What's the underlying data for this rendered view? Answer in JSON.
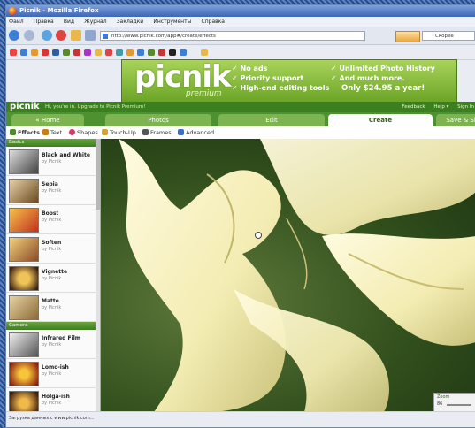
{
  "window": {
    "title": "Picnik - Mozilla Firefox"
  },
  "menu": [
    "Файл",
    "Правка",
    "Вид",
    "Журнал",
    "Закладки",
    "Инструменты",
    "Справка"
  ],
  "navbar": {
    "url": "http://www.picnik.com/app#/create/effects",
    "search_placeholder": "Скорее"
  },
  "ad": {
    "logo": "picnik",
    "sub": "premium",
    "left": [
      "No ads",
      "Priority support",
      "High-end editing tools"
    ],
    "right": [
      "Unlimited Photo History",
      "And much more."
    ],
    "price": "Only $24.95 a year!"
  },
  "picnikbar": {
    "logo": "picnik",
    "message": "Hi, you're in. Upgrade to Picnik Premium!",
    "links": [
      "Feedback",
      "Help ▾",
      "Sign In"
    ]
  },
  "tabs": [
    "« Home",
    "Photos",
    "Edit",
    "Create",
    "Save & Share"
  ],
  "active_tab": "Create",
  "subtabs": [
    "Effects",
    "Text",
    "Shapes",
    "Touch-Up",
    "Frames",
    "Advanced"
  ],
  "sections": [
    {
      "title": "Basics",
      "items": [
        {
          "name": "Black and White",
          "by": "by Picnik"
        },
        {
          "name": "Sepia",
          "by": "by Picnik"
        },
        {
          "name": "Boost",
          "by": "by Picnik"
        },
        {
          "name": "Soften",
          "by": "by Picnik"
        },
        {
          "name": "Vignette",
          "by": "by Picnik"
        },
        {
          "name": "Matte",
          "by": "by Picnik"
        }
      ]
    },
    {
      "title": "Camera",
      "items": [
        {
          "name": "Infrared Film",
          "by": "by Picnik"
        },
        {
          "name": "Lomo-ish",
          "by": "by Picnik"
        },
        {
          "name": "Holga-ish",
          "by": "by Picnik"
        }
      ]
    }
  ],
  "zoom": {
    "label": "Zoom",
    "value": "86"
  },
  "status": "Загрузка данных с www.picnik.com...",
  "colors": {
    "accent": "#3c7f21",
    "tab_active": "#ffffff",
    "ad_green": "#6aa426"
  }
}
